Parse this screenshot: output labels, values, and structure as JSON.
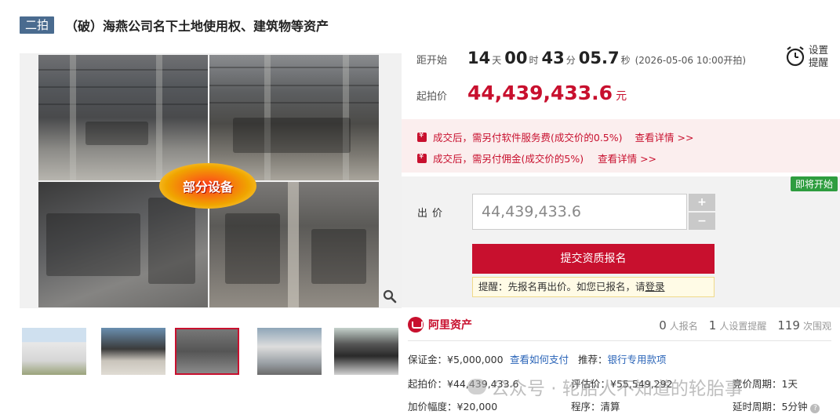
{
  "title": {
    "round": "二拍",
    "text": "（破）海燕公司名下土地使用权、建筑物等资产"
  },
  "gallery": {
    "overlay_label": "部分设备",
    "zoom_icon": "magnifier-icon",
    "thumbnail_count": 5,
    "active_thumbnail": 3
  },
  "countdown": {
    "label": "距开始",
    "days": "14",
    "days_unit": "天",
    "hours": "00",
    "hours_unit": "时",
    "minutes": "43",
    "minutes_unit": "分",
    "seconds": "05.7",
    "seconds_unit": "秒",
    "start_time": "(2026-05-06 10:00开拍)"
  },
  "reminder": {
    "icon": "alarm-clock-icon",
    "label": "设置提醒"
  },
  "start_price": {
    "label": "起拍价",
    "value": "44,439,433.6",
    "unit": "元"
  },
  "fees": [
    {
      "text": "成交后，需另付软件服务费(成交价的0.5%)",
      "link": "查看详情 >>"
    },
    {
      "text": "成交后，需另付佣金(成交价的5%)",
      "link": "查看详情 >>"
    }
  ],
  "bid": {
    "status": "即将开始",
    "label": "出价",
    "amount": "44,439,433.6",
    "increase_label": "+",
    "decrease_label": "−",
    "submit_label": "提交资质报名",
    "hint_text": "提醒：先报名再出价。如您已报名，请",
    "hint_link": "登录"
  },
  "platform": {
    "name": "阿里资产"
  },
  "stats": {
    "signups": "0",
    "signups_label": "人报名",
    "reminders": "1",
    "reminders_label": "人设置提醒",
    "views": "119",
    "views_label": "次围观"
  },
  "details": {
    "deposit_label": "保证金：",
    "deposit_value": "¥5,000,000",
    "pay_link": "查看如何支付",
    "recommend_label": "推荐：",
    "recommend_link": "银行专用款项",
    "start_price_label": "起拍价：",
    "start_price_value": "¥44,439,433.6",
    "appraisal_label": "评估价：",
    "appraisal_value": "¥55,549,292",
    "period_label": "竞价周期：",
    "period_value": "1天",
    "increment_label": "加价幅度：",
    "increment_value": "¥20,000",
    "procedure_label": "程序：",
    "procedure_value": "清算",
    "delay_label": "延时周期：",
    "delay_value": "5分钟"
  },
  "watermark": {
    "text": "公众号 · 轮胎人不知道的轮胎事"
  },
  "colors": {
    "accent": "#c8102e",
    "badge": "#4a6b8f",
    "status_green": "#2e9d3f",
    "link_blue": "#2a64b8"
  }
}
